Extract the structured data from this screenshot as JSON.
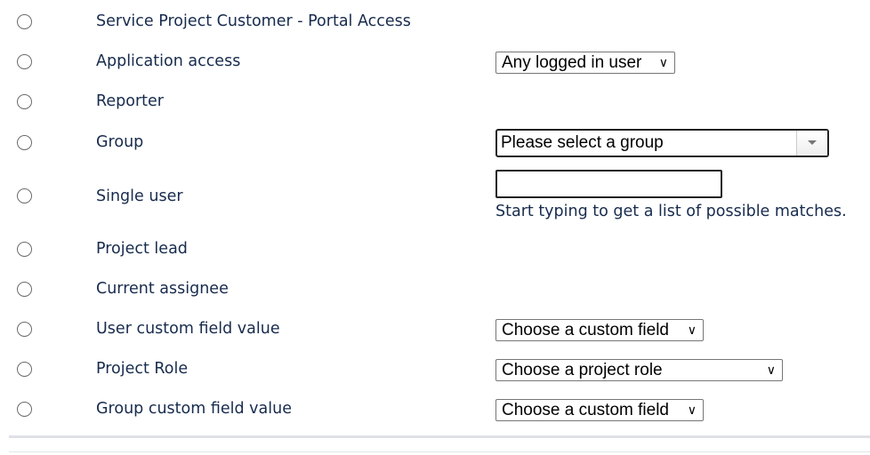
{
  "options": [
    {
      "label": "Service Project Customer - Portal Access"
    },
    {
      "label": "Application access",
      "select": "Any logged in user"
    },
    {
      "label": "Reporter"
    },
    {
      "label": "Group",
      "group_placeholder": "Please select a group"
    },
    {
      "label": "Single user",
      "input_value": "",
      "hint": "Start typing to get a list of possible matches."
    },
    {
      "label": "Project lead"
    },
    {
      "label": "Current assignee"
    },
    {
      "label": "User custom field value",
      "select": "Choose a custom field"
    },
    {
      "label": "Project Role",
      "select": "Choose a project role"
    },
    {
      "label": "Group custom field value",
      "select": "Choose a custom field"
    }
  ],
  "chevron": "⌄"
}
